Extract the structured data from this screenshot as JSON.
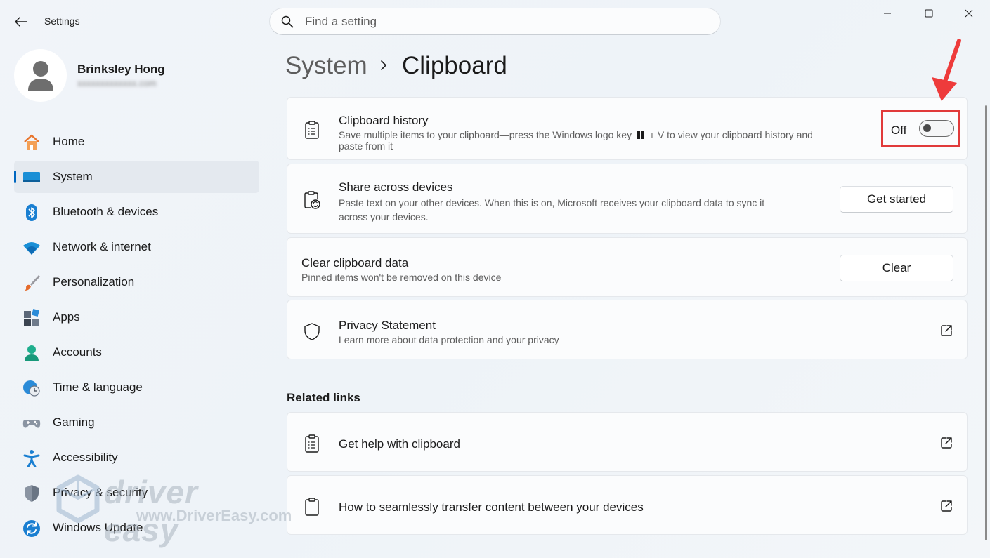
{
  "window": {
    "app_title": "Settings",
    "controls": {
      "minimize": "minimize",
      "maximize": "maximize",
      "close": "close"
    }
  },
  "search": {
    "placeholder": "Find a setting",
    "value": ""
  },
  "profile": {
    "name": "Brinksley Hong",
    "email": "xxxxxxxxxxxxx.com"
  },
  "nav": {
    "items": [
      {
        "label": "Home",
        "icon": "home-icon",
        "active": false
      },
      {
        "label": "System",
        "icon": "system-icon",
        "active": true
      },
      {
        "label": "Bluetooth & devices",
        "icon": "bluetooth-icon",
        "active": false
      },
      {
        "label": "Network & internet",
        "icon": "wifi-icon",
        "active": false
      },
      {
        "label": "Personalization",
        "icon": "brush-icon",
        "active": false
      },
      {
        "label": "Apps",
        "icon": "apps-icon",
        "active": false
      },
      {
        "label": "Accounts",
        "icon": "person-icon",
        "active": false
      },
      {
        "label": "Time & language",
        "icon": "globe-clock-icon",
        "active": false
      },
      {
        "label": "Gaming",
        "icon": "gamepad-icon",
        "active": false
      },
      {
        "label": "Accessibility",
        "icon": "accessibility-icon",
        "active": false
      },
      {
        "label": "Privacy & security",
        "icon": "shield-icon",
        "active": false
      },
      {
        "label": "Windows Update",
        "icon": "update-icon",
        "active": false
      }
    ]
  },
  "breadcrumb": {
    "parent": "System",
    "current": "Clipboard"
  },
  "cards": {
    "history": {
      "title": "Clipboard history",
      "desc_line1": "Save multiple items to your clipboard—press the Windows logo key",
      "desc_key": "+ V to view your clipboard history and",
      "desc_line2": "paste from it",
      "toggle_label": "Off",
      "toggle_on": false
    },
    "share": {
      "title": "Share across devices",
      "desc_line1": "Paste text on your other devices. When this is on, Microsoft receives your clipboard data to sync it",
      "desc_line2": "across your devices.",
      "button": "Get started"
    },
    "clear": {
      "title": "Clear clipboard data",
      "desc": "Pinned items won't be removed on this device",
      "button": "Clear"
    },
    "privacy": {
      "title": "Privacy Statement",
      "desc": "Learn more about data protection and your privacy"
    }
  },
  "related": {
    "title": "Related links",
    "links": [
      {
        "label": "Get help with clipboard",
        "icon": "clipboard-list-icon"
      },
      {
        "label": "How to seamlessly transfer content between your devices",
        "icon": "clipboard-icon"
      }
    ]
  },
  "watermark": {
    "main": "driver easy",
    "sub": "www.DriverEasy.com"
  },
  "colors": {
    "accent": "#0067c0",
    "highlight": "#e13a3a",
    "background": "#eef3f8",
    "card": "#fbfcfd"
  }
}
